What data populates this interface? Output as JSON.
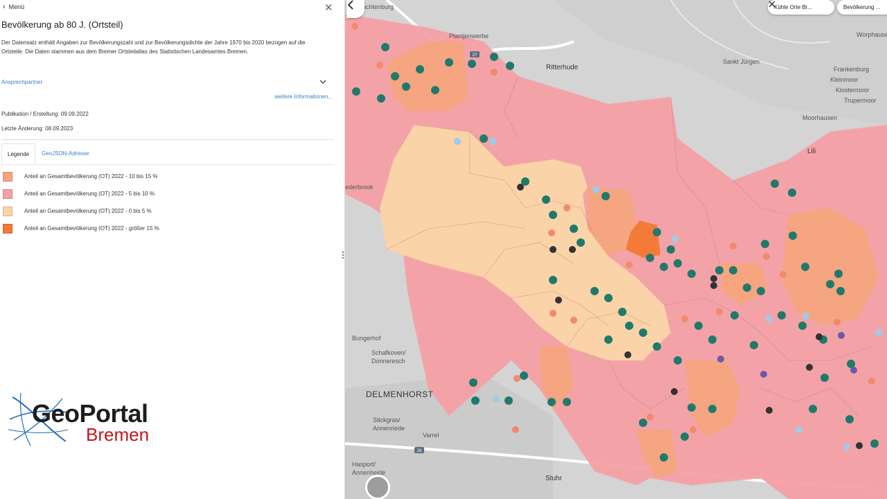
{
  "panel": {
    "menu_label": "Menü",
    "title": "Bevölkerung ab 80 J. (Ortsteil)",
    "description": "Der Datensatz enthält Angaben zur Bevölkerungszahl und zur Bevölkerungsdichte der Jahre 1970 bis 2020 bezogen auf die Ortsteile. Die Daten stammen aus dem Bremer Ortsteilatlas des Statistischen Landesamtes Bremen.",
    "contact_label": "Ansprechpartner",
    "more_info_label": "weitere Informationen...",
    "publication": "Publikation / Erstellung: 09.09.2022",
    "last_change": "Letzte Änderung: 08.09.2023",
    "tabs": [
      {
        "label": "Legende",
        "active": true
      },
      {
        "label": "GeoJSON-Adresse",
        "active": false
      }
    ],
    "legend": [
      {
        "label": "Anteil an Gesamtbevölkerung (OT) 2022 - 10 bis 15 %",
        "color": "#f5a580"
      },
      {
        "label": "Anteil an Gesamtbevölkerung (OT) 2022 - 5 bis 10 %",
        "color": "#f4a0a4"
      },
      {
        "label": "Anteil an Gesamtbevölkerung (OT) 2022 - 0 bis 5 %",
        "color": "#fbd3a8"
      },
      {
        "label": "Anteil an Gesamtbevölkerung (OT) 2022 - größer 15 %",
        "color": "#f47a38"
      }
    ],
    "logo": {
      "geo": "GeoPortal",
      "city": "Bremen"
    }
  },
  "map": {
    "chips": [
      {
        "label": "Kühle Orte Br..."
      },
      {
        "label": "Bevölkerung ..."
      }
    ],
    "place_labels": [
      "Ritterhude",
      "Sankt Jürgen",
      "Frankenburg",
      "Kleinmoor",
      "Klostermoor",
      "Trupermoor",
      "Moorhausen",
      "Worphausen",
      "Plantjenwerbe",
      "Lili",
      "Bungerhof",
      "Schafkoven/ Donneresch",
      "DELMENHORST",
      "Stickgras/ Annenriede",
      "Varrel",
      "Hasport/ Annenheide",
      "Stuhr",
      "euchtenburg",
      "ederbrook"
    ],
    "road_numbers": [
      "27",
      "28"
    ],
    "colors": {
      "ten_to_fifteen": "#f5a580",
      "five_to_ten": "#f4a0a4",
      "zero_to_five": "#fbd3a8",
      "over_fifteen": "#f47a38",
      "pin_green": "#1f7a6b",
      "pin_dark": "#333333",
      "pin_light_blue": "#9ccce8",
      "pin_purple": "#6a5aa8",
      "pin_salmon": "#f08a6a"
    }
  }
}
